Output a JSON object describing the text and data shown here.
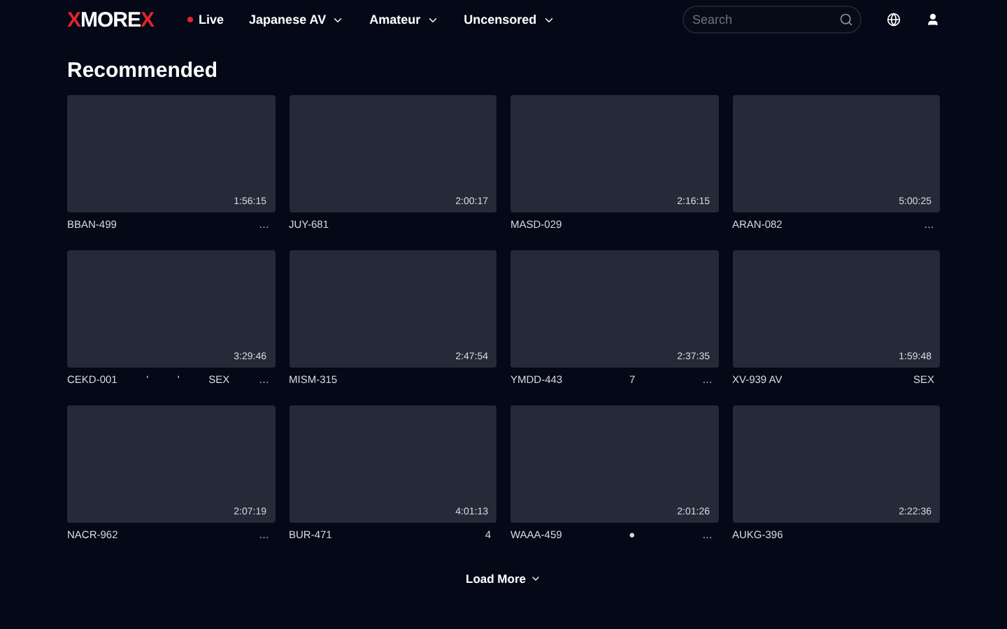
{
  "nav": {
    "logo": [
      {
        "text": "X",
        "accent": true
      },
      {
        "text": "MORE",
        "accent": false
      },
      {
        "text": "X",
        "accent": true
      }
    ],
    "live": "Live",
    "menus": [
      "Japanese AV",
      "Amateur",
      "Uncensored"
    ],
    "search": {
      "placeholder": "Search"
    }
  },
  "section_title": "Recommended",
  "videos": [
    {
      "duration": "1:56:15",
      "title_parts": [
        "BBAN-499",
        "…"
      ]
    },
    {
      "duration": "2:00:17",
      "title_parts": [
        "JUY-681"
      ]
    },
    {
      "duration": "2:16:15",
      "title_parts": [
        "MASD-029"
      ]
    },
    {
      "duration": "5:00:25",
      "title_parts": [
        "ARAN-082",
        "…"
      ]
    },
    {
      "duration": "3:29:46",
      "title_parts": [
        "CEKD-001",
        "'",
        "'",
        "SEX",
        "…"
      ]
    },
    {
      "duration": "2:47:54",
      "title_parts": [
        "MISM-315"
      ]
    },
    {
      "duration": "2:37:35",
      "title_parts": [
        "YMDD-443",
        "7",
        "…"
      ]
    },
    {
      "duration": "1:59:48",
      "title_parts": [
        "XV-939 AV",
        "SEX"
      ]
    },
    {
      "duration": "2:07:19",
      "title_parts": [
        "NACR-962",
        "…"
      ]
    },
    {
      "duration": "4:01:13",
      "title_parts": [
        "BUR-471",
        "4"
      ]
    },
    {
      "duration": "2:01:26",
      "title_parts": [
        "WAAA-459",
        "●",
        "…"
      ]
    },
    {
      "duration": "2:22:36",
      "title_parts": [
        "AUKG-396"
      ]
    }
  ],
  "load_more": "Load More"
}
